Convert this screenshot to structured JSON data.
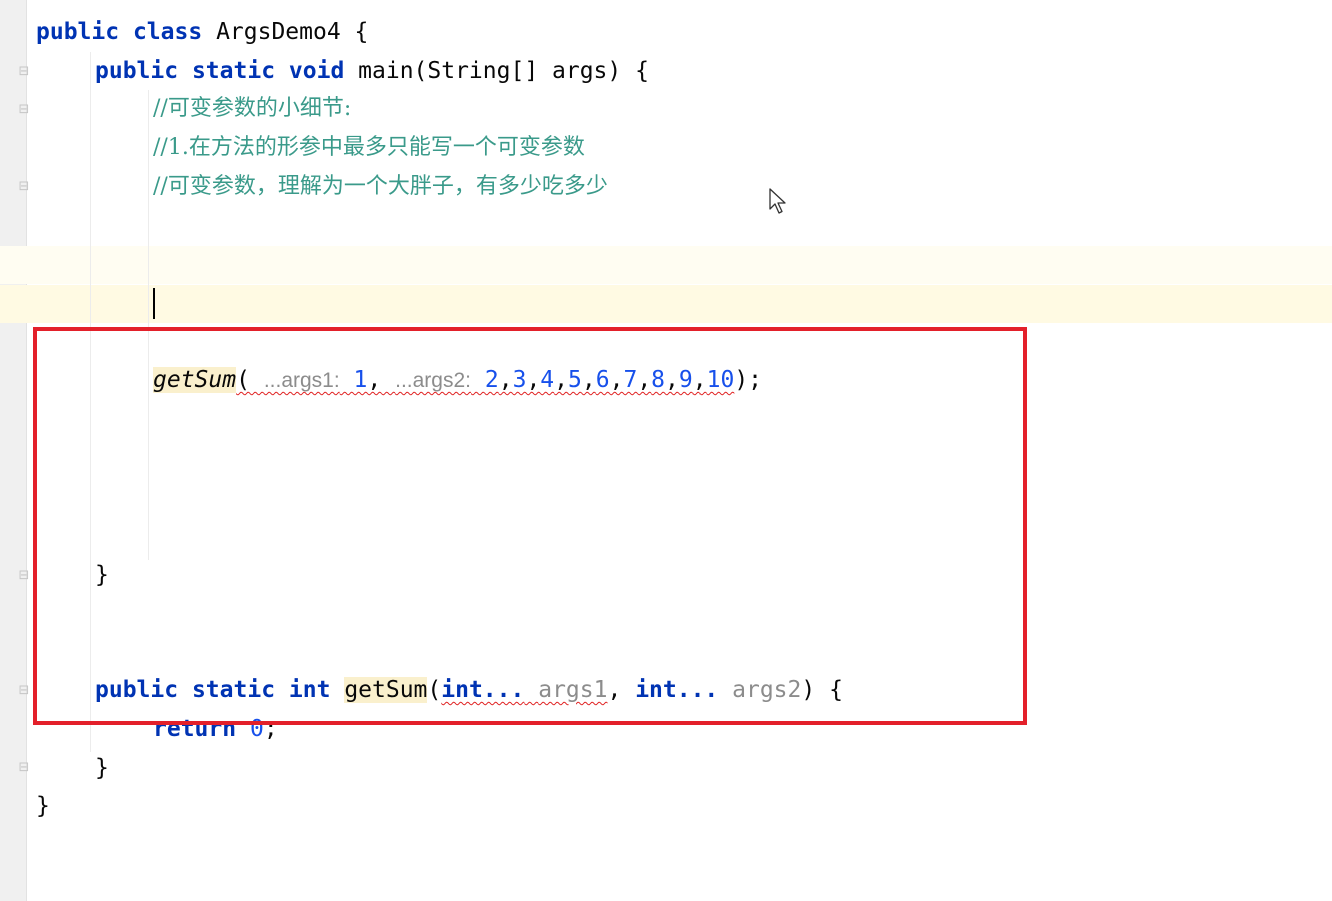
{
  "editor": {
    "lines": {
      "class_decl": {
        "kw1": "public",
        "kw2": "class",
        "name": "ArgsDemo4",
        "brace": "{"
      },
      "main_decl": {
        "kw1": "public",
        "kw2": "static",
        "kw3": "void",
        "rest": "main(String[] args) {"
      },
      "comment1": "//可变参数的小细节:",
      "comment2": "//1.在方法的形参中最多只能写一个可变参数",
      "comment3": "//可变参数，理解为一个大胖子，有多少吃多少",
      "call": {
        "fn": "getSum",
        "open": "(",
        "hint1": "...args1:",
        "arg1": "1",
        "sep1": ",",
        "hint2": "...args2:",
        "args2": [
          "2",
          "3",
          "4",
          "5",
          "6",
          "7",
          "8",
          "9",
          "10"
        ],
        "close": ");"
      },
      "main_close": "}",
      "getsum_decl": {
        "kw1": "public",
        "kw2": "static",
        "kw3": "int",
        "fn": "getSum",
        "open": "(",
        "type1": "int...",
        "param1": "args1",
        "comma": ",",
        "type2": "int...",
        "param2": "args2",
        "close": ") {"
      },
      "return_stmt": {
        "kw": "return",
        "value": "0",
        "end": ";"
      },
      "getsum_close": "}",
      "class_close": "}"
    }
  },
  "colors": {
    "keyword": "#0033b3",
    "comment": "#3a9a8a",
    "number": "#1750eb",
    "highlight_border": "#e3202a"
  },
  "icons": [
    "fold-marker-icon",
    "mouse-pointer-icon"
  ]
}
